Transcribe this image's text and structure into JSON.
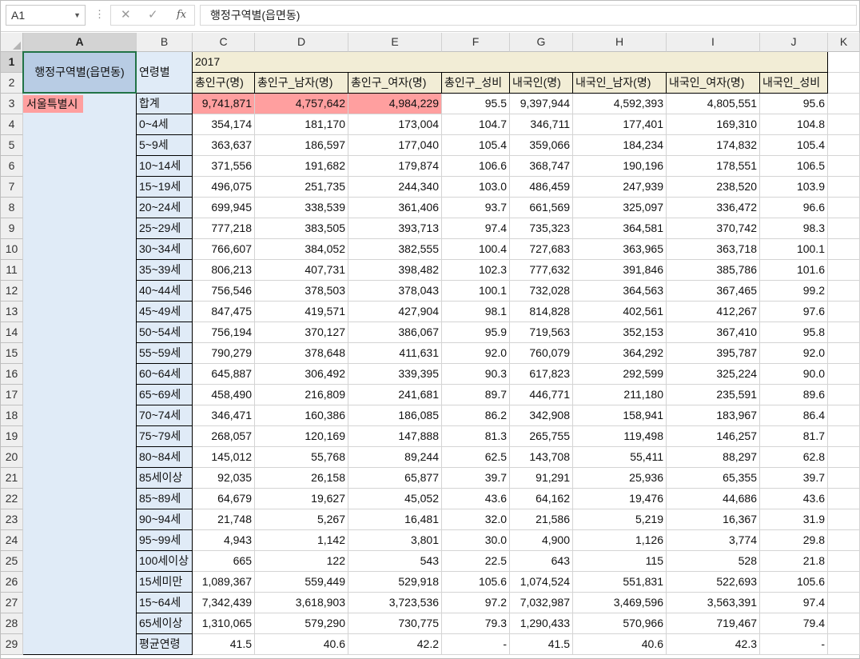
{
  "namebox": "A1",
  "formula_buttons": {
    "cancel": "✕",
    "enter": "✓",
    "fx": "fx"
  },
  "formula": "행정구역별(읍면동)",
  "columns": [
    "A",
    "B",
    "C",
    "D",
    "E",
    "F",
    "G",
    "H",
    "I",
    "J",
    "K"
  ],
  "rows": [
    "1",
    "2",
    "3",
    "4",
    "5",
    "6",
    "7",
    "8",
    "9",
    "10",
    "11",
    "12",
    "13",
    "14",
    "15",
    "16",
    "17",
    "18",
    "19",
    "20",
    "21",
    "22",
    "23",
    "24",
    "25",
    "26",
    "27",
    "28",
    "29"
  ],
  "cells": {
    "a1": "행정구역별(읍면동)",
    "b1": "연령별",
    "c1": "2017",
    "a3": "서울특별시"
  },
  "headers": [
    "총인구(명)",
    "총인구_남자(명)",
    "총인구_여자(명)",
    "총인구_성비",
    "내국인(명)",
    "내국인_남자(명)",
    "내국인_여자(명)",
    "내국인_성비"
  ],
  "data": [
    [
      "합계",
      "9,741,871",
      "4,757,642",
      "4,984,229",
      "95.5",
      "9,397,944",
      "4,592,393",
      "4,805,551",
      "95.6"
    ],
    [
      "0~4세",
      "354,174",
      "181,170",
      "173,004",
      "104.7",
      "346,711",
      "177,401",
      "169,310",
      "104.8"
    ],
    [
      "5~9세",
      "363,637",
      "186,597",
      "177,040",
      "105.4",
      "359,066",
      "184,234",
      "174,832",
      "105.4"
    ],
    [
      "10~14세",
      "371,556",
      "191,682",
      "179,874",
      "106.6",
      "368,747",
      "190,196",
      "178,551",
      "106.5"
    ],
    [
      "15~19세",
      "496,075",
      "251,735",
      "244,340",
      "103.0",
      "486,459",
      "247,939",
      "238,520",
      "103.9"
    ],
    [
      "20~24세",
      "699,945",
      "338,539",
      "361,406",
      "93.7",
      "661,569",
      "325,097",
      "336,472",
      "96.6"
    ],
    [
      "25~29세",
      "777,218",
      "383,505",
      "393,713",
      "97.4",
      "735,323",
      "364,581",
      "370,742",
      "98.3"
    ],
    [
      "30~34세",
      "766,607",
      "384,052",
      "382,555",
      "100.4",
      "727,683",
      "363,965",
      "363,718",
      "100.1"
    ],
    [
      "35~39세",
      "806,213",
      "407,731",
      "398,482",
      "102.3",
      "777,632",
      "391,846",
      "385,786",
      "101.6"
    ],
    [
      "40~44세",
      "756,546",
      "378,503",
      "378,043",
      "100.1",
      "732,028",
      "364,563",
      "367,465",
      "99.2"
    ],
    [
      "45~49세",
      "847,475",
      "419,571",
      "427,904",
      "98.1",
      "814,828",
      "402,561",
      "412,267",
      "97.6"
    ],
    [
      "50~54세",
      "756,194",
      "370,127",
      "386,067",
      "95.9",
      "719,563",
      "352,153",
      "367,410",
      "95.8"
    ],
    [
      "55~59세",
      "790,279",
      "378,648",
      "411,631",
      "92.0",
      "760,079",
      "364,292",
      "395,787",
      "92.0"
    ],
    [
      "60~64세",
      "645,887",
      "306,492",
      "339,395",
      "90.3",
      "617,823",
      "292,599",
      "325,224",
      "90.0"
    ],
    [
      "65~69세",
      "458,490",
      "216,809",
      "241,681",
      "89.7",
      "446,771",
      "211,180",
      "235,591",
      "89.6"
    ],
    [
      "70~74세",
      "346,471",
      "160,386",
      "186,085",
      "86.2",
      "342,908",
      "158,941",
      "183,967",
      "86.4"
    ],
    [
      "75~79세",
      "268,057",
      "120,169",
      "147,888",
      "81.3",
      "265,755",
      "119,498",
      "146,257",
      "81.7"
    ],
    [
      "80~84세",
      "145,012",
      "55,768",
      "89,244",
      "62.5",
      "143,708",
      "55,411",
      "88,297",
      "62.8"
    ],
    [
      "85세이상",
      "92,035",
      "26,158",
      "65,877",
      "39.7",
      "91,291",
      "25,936",
      "65,355",
      "39.7"
    ],
    [
      "85~89세",
      "64,679",
      "19,627",
      "45,052",
      "43.6",
      "64,162",
      "19,476",
      "44,686",
      "43.6"
    ],
    [
      "90~94세",
      "21,748",
      "5,267",
      "16,481",
      "32.0",
      "21,586",
      "5,219",
      "16,367",
      "31.9"
    ],
    [
      "95~99세",
      "4,943",
      "1,142",
      "3,801",
      "30.0",
      "4,900",
      "1,126",
      "3,774",
      "29.8"
    ],
    [
      "100세이상",
      "665",
      "122",
      "543",
      "22.5",
      "643",
      "115",
      "528",
      "21.8"
    ],
    [
      "15세미만",
      "1,089,367",
      "559,449",
      "529,918",
      "105.6",
      "1,074,524",
      "551,831",
      "522,693",
      "105.6"
    ],
    [
      "15~64세",
      "7,342,439",
      "3,618,903",
      "3,723,536",
      "97.2",
      "7,032,987",
      "3,469,596",
      "3,563,391",
      "97.4"
    ],
    [
      "65세이상",
      "1,310,065",
      "579,290",
      "730,775",
      "79.3",
      "1,290,433",
      "570,966",
      "719,467",
      "79.4"
    ],
    [
      "평균연령",
      "41.5",
      "40.6",
      "42.2",
      "-",
      "41.5",
      "40.6",
      "42.3",
      "-"
    ]
  ]
}
